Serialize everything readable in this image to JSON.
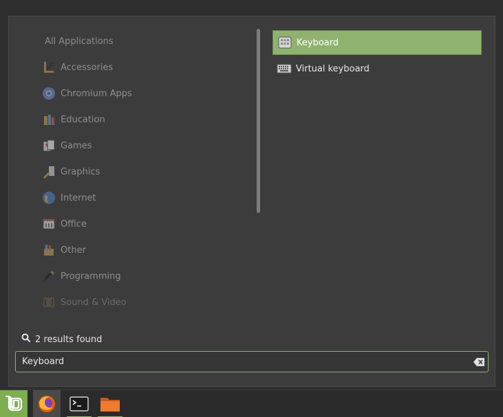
{
  "menu": {
    "all_label": "All Applications",
    "categories": [
      {
        "label": "Accessories",
        "icon": "accessories-icon"
      },
      {
        "label": "Chromium Apps",
        "icon": "chromium-icon"
      },
      {
        "label": "Education",
        "icon": "education-icon"
      },
      {
        "label": "Games",
        "icon": "games-icon"
      },
      {
        "label": "Graphics",
        "icon": "graphics-icon"
      },
      {
        "label": "Internet",
        "icon": "internet-icon"
      },
      {
        "label": "Office",
        "icon": "office-icon"
      },
      {
        "label": "Other",
        "icon": "other-icon"
      },
      {
        "label": "Programming",
        "icon": "programming-icon"
      },
      {
        "label": "Sound & Video",
        "icon": "sound-video-icon"
      }
    ],
    "results": [
      {
        "label": "Keyboard",
        "icon": "keyboard-settings-icon",
        "selected": true
      },
      {
        "label": "Virtual keyboard",
        "icon": "virtual-keyboard-icon",
        "selected": false
      }
    ],
    "status_text": "2 results found",
    "search": {
      "value": "Keyboard"
    }
  },
  "colors": {
    "accent": "#8fb36f",
    "menu_bg": "#3c3c3c",
    "panel_bg": "#2b2b2b"
  },
  "panel": {
    "items": [
      "mint-menu-icon",
      "firefox-icon",
      "terminal-icon",
      "files-folder-icon"
    ]
  }
}
